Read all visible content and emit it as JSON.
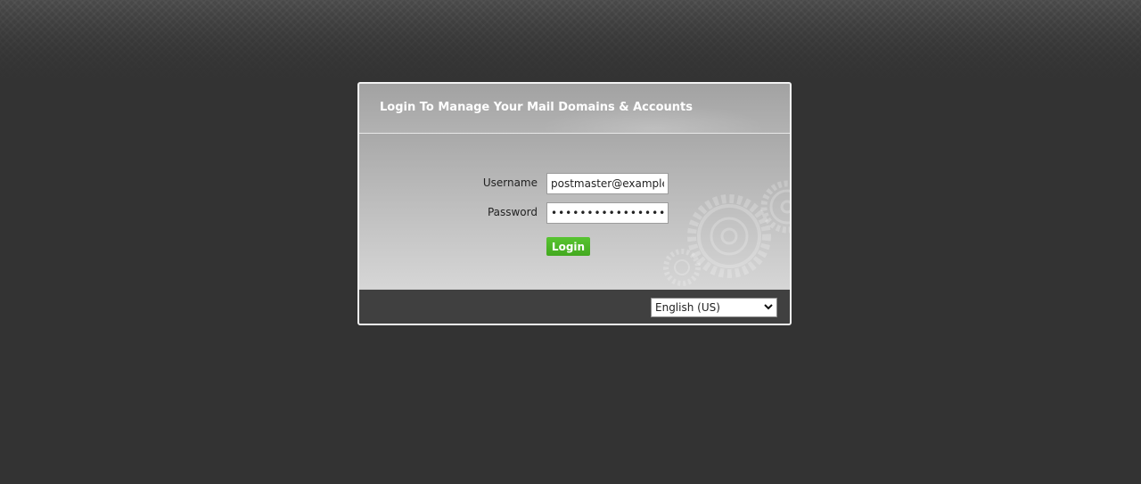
{
  "login": {
    "title": "Login To Manage Your Mail Domains & Accounts",
    "username_label": "Username",
    "username_value": "postmaster@example.com",
    "password_label": "Password",
    "password_value": "••••••••••••••••",
    "login_button": "Login"
  },
  "language": {
    "selected": "English (US)",
    "options": [
      "English (US)"
    ]
  },
  "colors": {
    "background": "#333333",
    "accent_green": "#4cb826",
    "footer": "#404040"
  },
  "icons": {
    "decoration": "gears-icon",
    "select_arrow": "chevron-down-icon"
  }
}
